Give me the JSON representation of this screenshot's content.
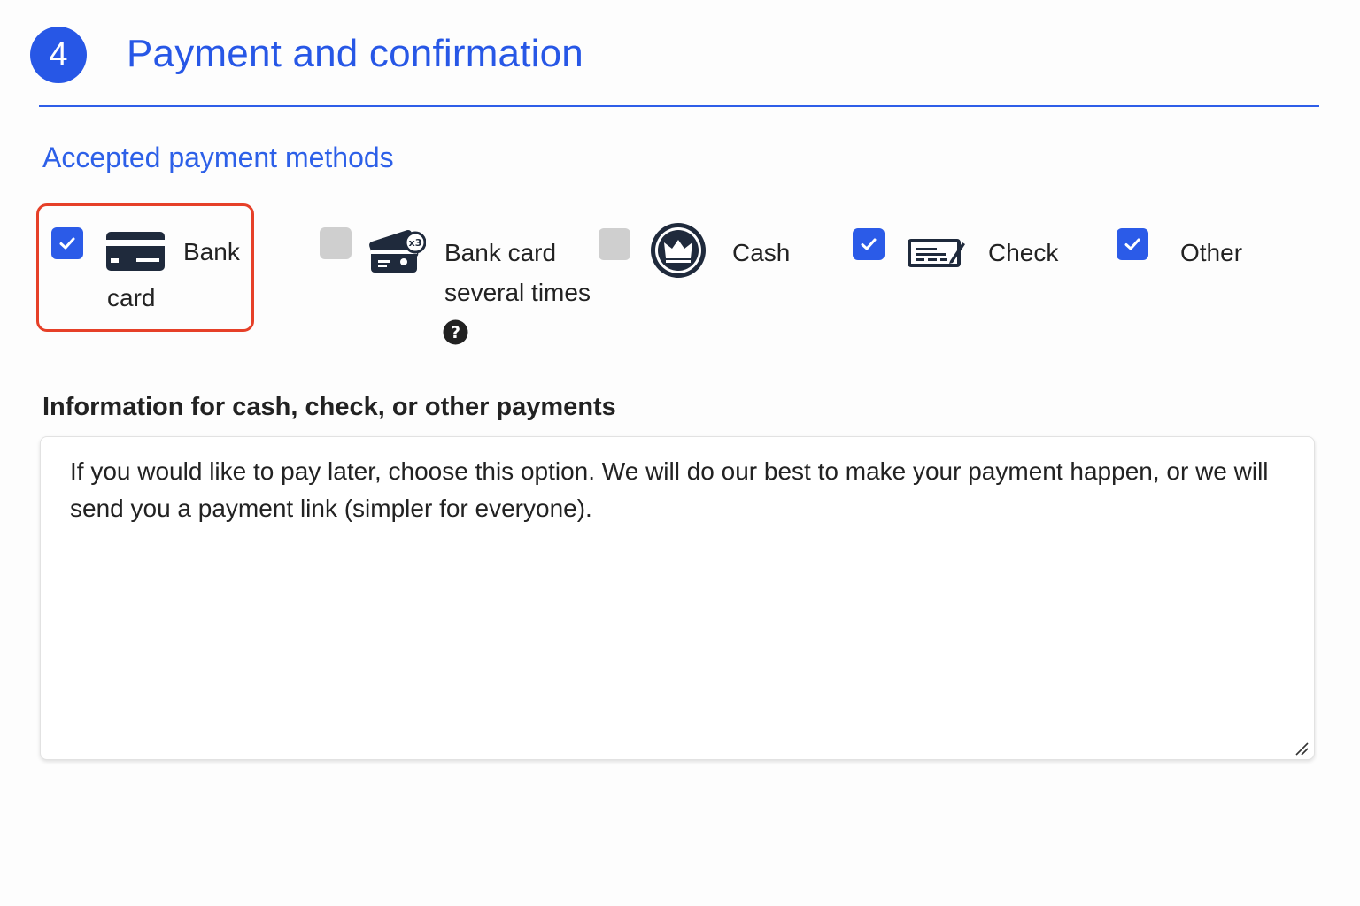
{
  "header": {
    "step_number": "4",
    "title": "Payment and confirmation"
  },
  "payment_methods": {
    "heading": "Accepted payment methods",
    "items": [
      {
        "label_line1": "Bank",
        "label_line2": "card",
        "checked": true,
        "icon": "credit-card-icon",
        "highlighted": true
      },
      {
        "label_line1": "Bank card",
        "label_line2": "several times",
        "checked": false,
        "icon": "card-installments-icon",
        "has_help": true
      },
      {
        "label_line1": "Cash",
        "label_line2": "",
        "checked": false,
        "icon": "cash-coin-icon"
      },
      {
        "label_line1": "Check",
        "label_line2": "",
        "checked": true,
        "icon": "check-payment-icon"
      },
      {
        "label_line1": "Other",
        "label_line2": "",
        "checked": true,
        "icon": ""
      }
    ]
  },
  "info": {
    "label": "Information for cash, check, or other payments",
    "value": "If you would like to pay later, choose this option. We will do our best to make your payment happen, or we will send you a payment link (simpler for everyone)."
  },
  "colors": {
    "accent": "#2757e6",
    "highlight": "#e64028",
    "checkbox_unchecked": "#cfcfcf",
    "icon_dark": "#1f2a3c"
  }
}
